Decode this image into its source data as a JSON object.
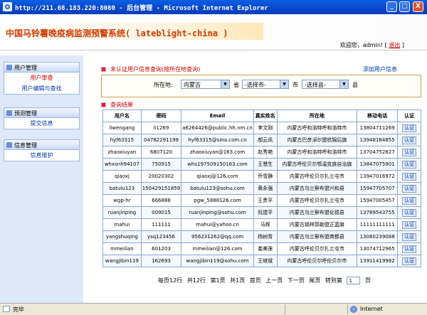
{
  "window": {
    "title": "http://211.68.183.220:8080 - 后台管理 - Microsoft Internet Explorer",
    "minimize": "_",
    "maximize": "□",
    "close": "X"
  },
  "header": {
    "logo_text": "中国马铃薯晚疫病监测预警系统( lateblight-china )",
    "welcome_prefix": "欢迎您，admin!",
    "logout_label": "退出",
    "bracket_open": "[",
    "bracket_close": "]"
  },
  "sidebar": {
    "groups": [
      {
        "title": "用户管理",
        "items": [
          {
            "label": "用户审查",
            "active": true
          },
          {
            "label": "用户编辑与查找",
            "active": false
          }
        ]
      },
      {
        "title": "预测管理",
        "items": [
          {
            "label": "提交信息",
            "active": false
          }
        ]
      },
      {
        "title": "信息管理",
        "items": [
          {
            "label": "信息维护",
            "active": false
          }
        ]
      }
    ]
  },
  "search_section": {
    "title": "未认证用户信息查询(按所在地查询)",
    "add_user_link": "添加用户信息",
    "location_label": "所在地:",
    "province_value": "内蒙古",
    "province_suffix": "省",
    "city_value": "-选择市-",
    "city_suffix": "市",
    "county_value": "-选择县-",
    "county_suffix": "县"
  },
  "results_section": {
    "title": "查询结果",
    "columns": [
      "用户名",
      "密码",
      "Email",
      "真实姓名",
      "所在地",
      "移动电话",
      "认证"
    ],
    "verify_label": "认证",
    "rows": [
      [
        "liwengang",
        "li1269",
        "a6264426@public.hh.nm.cn",
        "李文刚",
        "内蒙古呼和浩特呼和浩特市",
        "13804711269"
      ],
      [
        "hyf63315",
        "04782291199",
        "hyf63315@sina.com.cn",
        "郝云凤",
        "内蒙古巴彦淖尔盟杭锦后旗",
        "13948184855"
      ],
      [
        "zhaoxiuyan",
        "6807120",
        "zhaoxiuyan@163.com",
        "赵秀艳",
        "内蒙古呼和浩特呼和浩特市",
        "13704752827"
      ],
      [
        "whxsnh94107",
        "750915",
        "whs197509150163.com",
        "王慧生",
        "内蒙古呼伦贝尔鄂温克族自治旗",
        "13847075901"
      ],
      [
        "qiaoxj",
        "20020302",
        "qiaoxj@126.com",
        "乔雪静",
        "内蒙古呼伦贝尔扎兰屯市",
        "13947016972"
      ],
      [
        "batulu123",
        "150429151859",
        "batulu123@sohu.com",
        "黄永强",
        "内蒙古乌兰察布盟兴和县",
        "15947705707"
      ],
      [
        "wgp-hr",
        "666888",
        "pgw_5888126.com",
        "王贵平",
        "内蒙古呼伦贝尔扎兰屯市",
        "15947005457"
      ],
      [
        "ruanjinping",
        "009015",
        "ruanjinping@sohu.com",
        "阮建平",
        "内蒙古乌兰察布盟化德县",
        "13789543755"
      ],
      [
        "mahui",
        "111111",
        "mahui@yahoo.cn",
        "马辉",
        "内蒙古锡林郭勒盟正蓝旗",
        "11111111111"
      ],
      [
        "yangshuqing",
        "ysq123456",
        "956231262@qq.com",
        "杨树青",
        "内蒙古乌兰察布盟商都县",
        "13080239088"
      ],
      [
        "mmeilian",
        "601203",
        "mmeilian@126.com",
        "娄美莲",
        "内蒙古呼伦贝尔扎兰屯市",
        "13074712965"
      ],
      [
        "wangjibin119",
        "162693",
        "wangjibin119@sohu.com",
        "王继斌",
        "内蒙古呼伦贝尔呼伦贝尔市",
        "13911419982"
      ]
    ]
  },
  "pager": {
    "per_page": "每页12行",
    "total_rows": "共12行",
    "current_page": "第1页",
    "total_pages": "共1页",
    "first": "首页",
    "prev": "上一页",
    "next": "下一页",
    "last": "尾页",
    "goto": "转到第",
    "page_select": "1",
    "page_suffix": "页"
  },
  "statusbar": {
    "status": "完毕",
    "zone": "Internet"
  }
}
